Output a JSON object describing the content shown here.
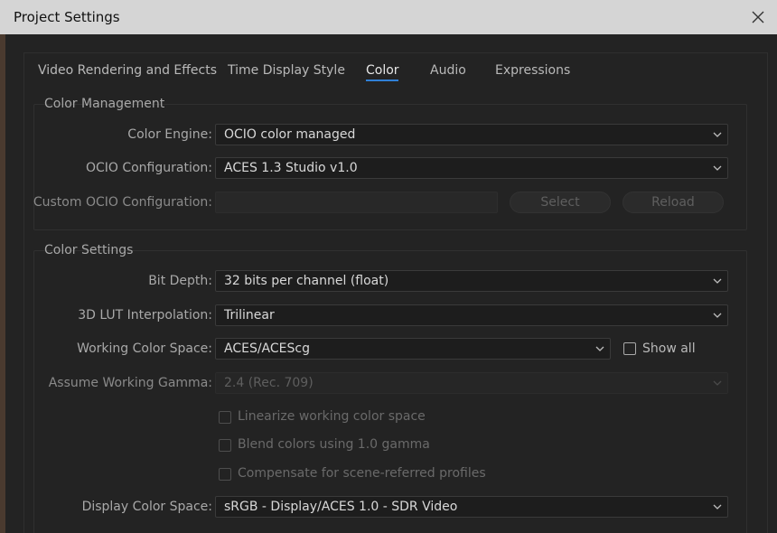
{
  "window": {
    "title": "Project Settings"
  },
  "tabs": [
    {
      "label": "Video Rendering and Effects",
      "active": false
    },
    {
      "label": "Time Display Style",
      "active": false
    },
    {
      "label": "Color",
      "active": true
    },
    {
      "label": "Audio",
      "active": false
    },
    {
      "label": "Expressions",
      "active": false
    }
  ],
  "color_management": {
    "title": "Color Management",
    "color_engine": {
      "label": "Color Engine:",
      "value": "OCIO color managed"
    },
    "ocio_configuration": {
      "label": "OCIO Configuration:",
      "value": "ACES 1.3 Studio v1.0"
    },
    "custom_ocio": {
      "label": "Custom OCIO Configuration:",
      "value": "",
      "select_label": "Select",
      "reload_label": "Reload"
    }
  },
  "color_settings": {
    "title": "Color Settings",
    "bit_depth": {
      "label": "Bit Depth:",
      "value": "32 bits per channel (float)"
    },
    "lut_interpolation": {
      "label": "3D LUT Interpolation:",
      "value": "Trilinear"
    },
    "working_color_space": {
      "label": "Working Color Space:",
      "value": "ACES/ACEScg",
      "show_all_label": "Show all",
      "show_all_checked": false
    },
    "working_gamma": {
      "label": "Assume Working Gamma:",
      "value": "2.4 (Rec. 709)"
    },
    "linearize": {
      "label": "Linearize working color space",
      "checked": false
    },
    "blend_gamma": {
      "label": "Blend colors using 1.0 gamma",
      "checked": false
    },
    "compensate": {
      "label": "Compensate for scene-referred profiles",
      "checked": false
    },
    "display_color_space": {
      "label": "Display Color Space:",
      "value": "sRGB - Display/ACES 1.0 - SDR Video"
    }
  },
  "colors": {
    "accent": "#2f7fd6",
    "titlebar": "#d5d5d5",
    "background": "#232323"
  },
  "icons": {
    "close": "close-icon",
    "dropdown": "chevron-down-icon"
  }
}
